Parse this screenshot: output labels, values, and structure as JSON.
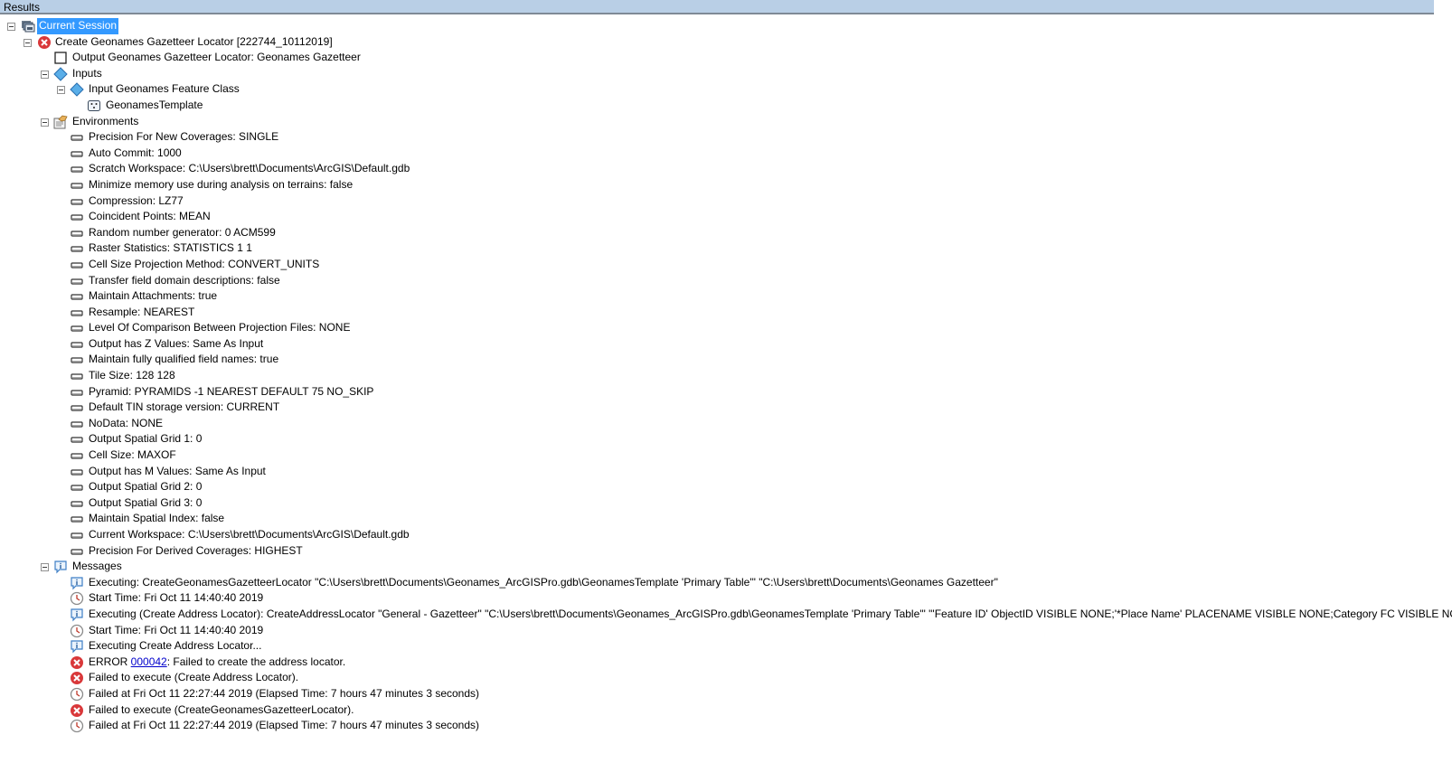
{
  "panel": {
    "title": "Results"
  },
  "session": {
    "label": "Current Session"
  },
  "tool": {
    "label": "Create Geonames Gazetteer Locator [222744_10112019]",
    "output": "Output Geonames Gazetteer Locator: Geonames Gazetteer",
    "inputs_label": "Inputs",
    "input_fc_label": "Input Geonames Feature Class",
    "input_fc_value": "GeonamesTemplate",
    "environments_label": "Environments",
    "environments": [
      "Precision For New Coverages: SINGLE",
      "Auto Commit: 1000",
      "Scratch Workspace: C:\\Users\\brett\\Documents\\ArcGIS\\Default.gdb",
      "Minimize memory use during analysis on terrains: false",
      "Compression: LZ77",
      "Coincident Points: MEAN",
      "Random number generator: 0 ACM599",
      "Raster Statistics: STATISTICS 1 1",
      "Cell Size Projection Method: CONVERT_UNITS",
      "Transfer field domain descriptions: false",
      "Maintain Attachments: true",
      "Resample: NEAREST",
      "Level Of Comparison Between Projection Files: NONE",
      "Output has Z Values: Same As Input",
      "Maintain fully qualified field names: true",
      "Tile Size: 128 128",
      "Pyramid: PYRAMIDS -1 NEAREST DEFAULT 75 NO_SKIP",
      "Default TIN storage version: CURRENT",
      "NoData: NONE",
      "Output Spatial Grid 1: 0",
      "Cell Size: MAXOF",
      "Output has M Values: Same As Input",
      "Output Spatial Grid 2: 0",
      "Output Spatial Grid 3: 0",
      "Maintain Spatial Index: false",
      "Current Workspace: C:\\Users\\brett\\Documents\\ArcGIS\\Default.gdb",
      "Precision For Derived Coverages: HIGHEST"
    ],
    "messages_label": "Messages",
    "messages": [
      {
        "type": "info",
        "text": "Executing: CreateGeonamesGazetteerLocator \"C:\\Users\\brett\\Documents\\Geonames_ArcGISPro.gdb\\GeonamesTemplate 'Primary Table'\" \"C:\\Users\\brett\\Documents\\Geonames Gazetteer\""
      },
      {
        "type": "time",
        "text": "Start Time: Fri Oct 11 14:40:40 2019"
      },
      {
        "type": "info",
        "text": "Executing (Create Address Locator): CreateAddressLocator \"General - Gazetteer\" \"C:\\Users\\brett\\Documents\\Geonames_ArcGISPro.gdb\\GeonamesTemplate 'Primary Table'\" \"'Feature ID' ObjectID VISIBLE NONE;'*Place Name' PLACENAME VISIBLE NONE;Category FC VISIBLE NONE"
      },
      {
        "type": "time",
        "text": "Start Time: Fri Oct 11 14:40:40 2019"
      },
      {
        "type": "info",
        "text": "Executing Create Address Locator..."
      },
      {
        "type": "error",
        "prefix": "ERROR ",
        "link": "000042",
        "suffix": ": Failed to create the address locator."
      },
      {
        "type": "error",
        "text": "Failed to execute (Create Address Locator)."
      },
      {
        "type": "time",
        "text": "Failed at Fri Oct 11 22:27:44 2019 (Elapsed Time: 7 hours 47 minutes 3 seconds)"
      },
      {
        "type": "error",
        "text": "Failed to execute (CreateGeonamesGazetteerLocator)."
      },
      {
        "type": "time",
        "text": "Failed at Fri Oct 11 22:27:44 2019 (Elapsed Time: 7 hours 47 minutes 3 seconds)"
      }
    ]
  },
  "colors": {
    "selection": "#3399ff",
    "header": "#b9cfe6",
    "error": "#d9383a",
    "link": "#0000cc"
  }
}
